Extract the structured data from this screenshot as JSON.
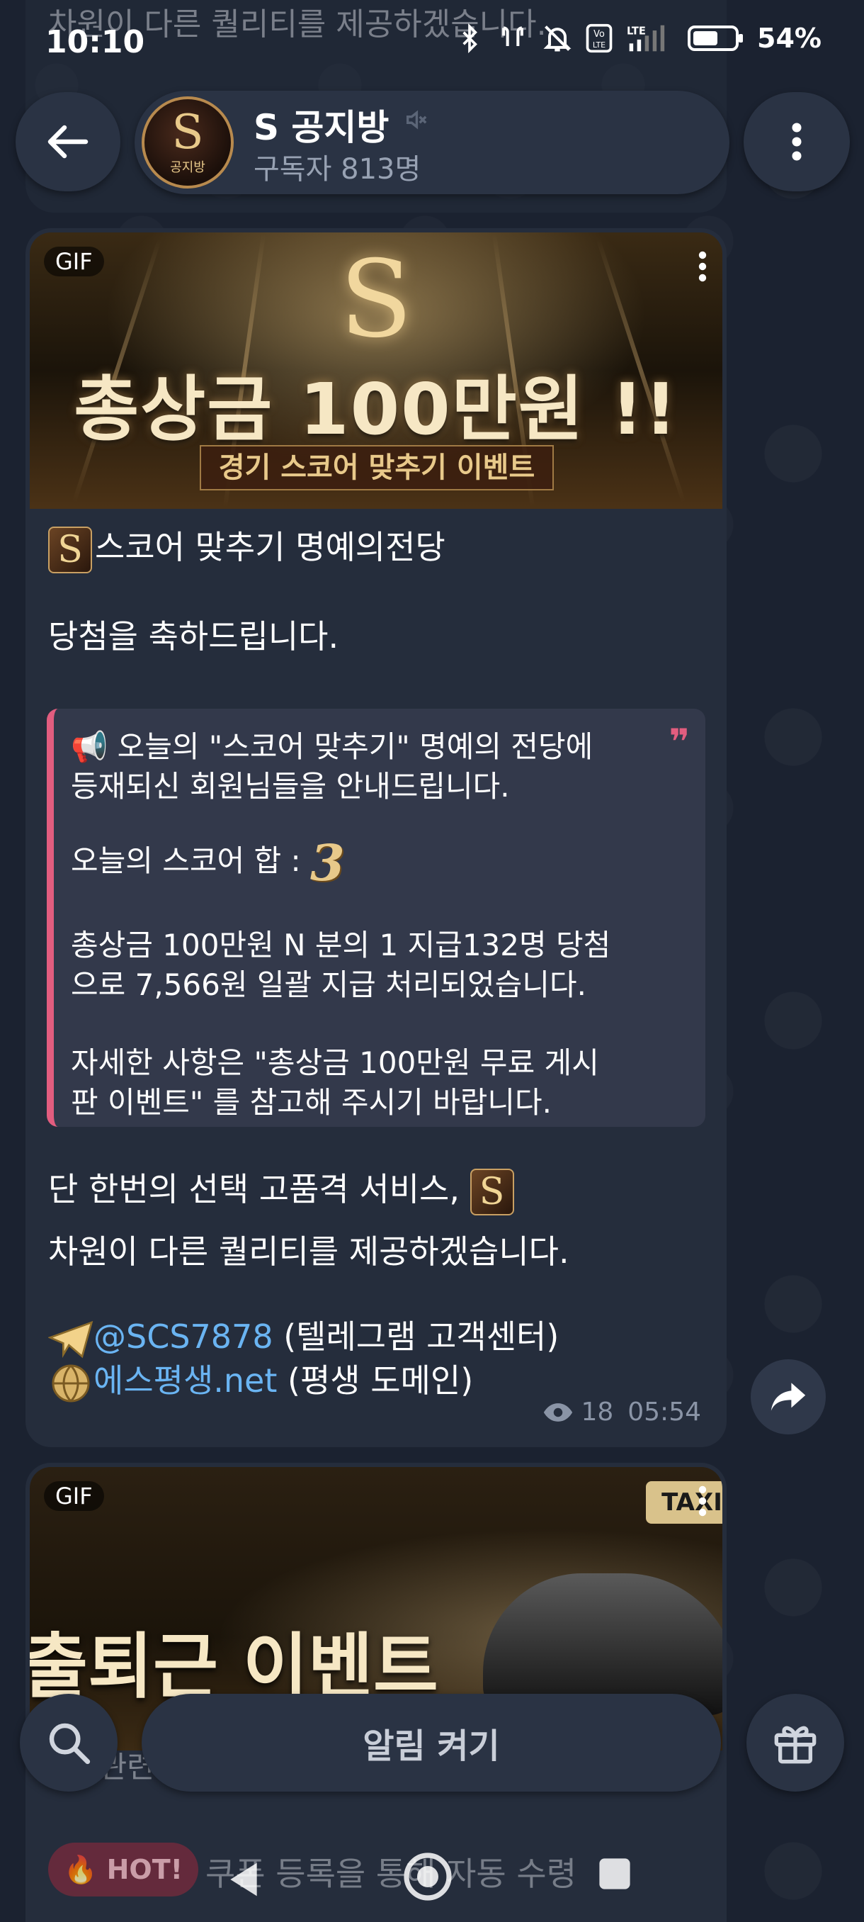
{
  "status_bar": {
    "time": "10:10",
    "battery": "54%",
    "network": "LTE"
  },
  "background_peek": {
    "top_text": "차원이 다른 퀄리티를 제공하겠습니다.",
    "bottom_text": "택시 관련 이벤트",
    "hot_badge": "🔥 HOT!",
    "bottom_text2": "쿠폰 등록을 통해 자동 수령"
  },
  "header": {
    "channel_name": "S 공지방",
    "subscribers": "구독자 813명",
    "avatar_letter": "S",
    "avatar_caption": "공지방"
  },
  "message": {
    "gif_badge": "GIF",
    "banner": {
      "letter": "S",
      "title": "총상금 100만원 !!",
      "subtitle": "경기 스코어 맞추기 이벤트"
    },
    "heading_emoji": "S",
    "heading": "스코어 맞추기 명예의전당",
    "congrats": "당첨을 축하드립니다.",
    "quote": {
      "line1": "📢 오늘의 \"스코어 맞추기\" 명예의 전당에",
      "line2": "등재되신 회원님들을 안내드립니다.",
      "score_label": "오늘의 스코어 합 :",
      "score_value": "3",
      "line3": "총상금 100만원 N 분의 1 지급132명 당첨",
      "line4": "으로 7,566원 일괄 지급 처리되었습니다.",
      "line5": "자세한 사항은 \"총상금 100만원 무료 게시",
      "line6": "판 이벤트\" 를 참고해 주시기 바랍니다.",
      "mark": "❞"
    },
    "closing1": "단 한번의 선택 고품격 서비스,",
    "closing_emoji": "S",
    "closing2": "차원이 다른 퀄리티를 제공하겠습니다.",
    "contact_link": "@SCS7878",
    "contact_desc": " (텔레그램 고객센터)",
    "domain_link": "에스평생.net",
    "domain_desc": " (평생 도메인)",
    "views": "18",
    "time": "05:54"
  },
  "message2": {
    "gif_badge": "GIF",
    "banner_text": "출퇴근 이벤트",
    "taxi_sign": "TAXI"
  },
  "bottom_bar": {
    "notify_label": "알림 켜기"
  },
  "colors": {
    "background": "#1b2230",
    "bubble": "#252d3c",
    "quote_bar": "#e25d7f",
    "link": "#6ab4f2",
    "gold": "#e8c98a"
  }
}
